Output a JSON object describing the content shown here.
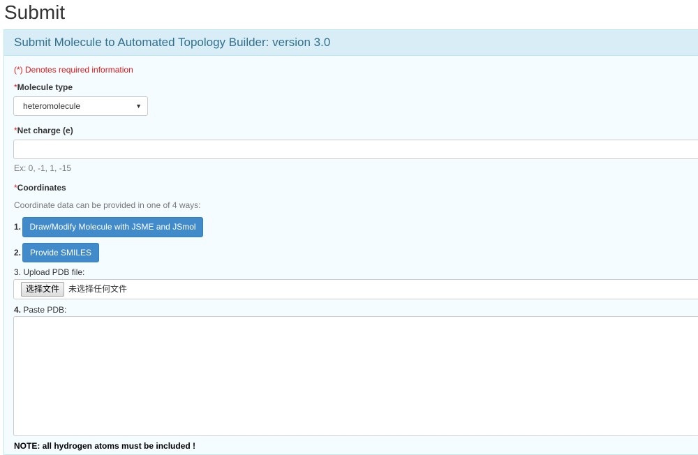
{
  "page": {
    "title": "Submit"
  },
  "panel": {
    "heading": "Submit Molecule to Automated Topology Builder: version 3.0",
    "required_note": "(*) Denotes required information"
  },
  "molecule_type": {
    "star": "*",
    "label": "Molecule type",
    "selected": "heteromolecule"
  },
  "net_charge": {
    "star": "*",
    "label": "Net charge (e)",
    "value": "",
    "hint": "Ex: 0, -1, 1, -15"
  },
  "coordinates": {
    "star": "*",
    "label": "Coordinates",
    "hint": "Coordinate data can be provided in one of 4 ways:",
    "option1": {
      "num": "1.",
      "button": "Draw/Modify Molecule with JSME and JSmol"
    },
    "option2": {
      "num": "2.",
      "button": "Provide SMILES"
    },
    "option3": {
      "label": "3. Upload PDB file:",
      "choose_button": "选择文件",
      "status": "未选择任何文件"
    },
    "option4": {
      "num": "4.",
      "label": "Paste PDB:"
    }
  },
  "note": "NOTE: all hydrogen atoms must be included !"
}
